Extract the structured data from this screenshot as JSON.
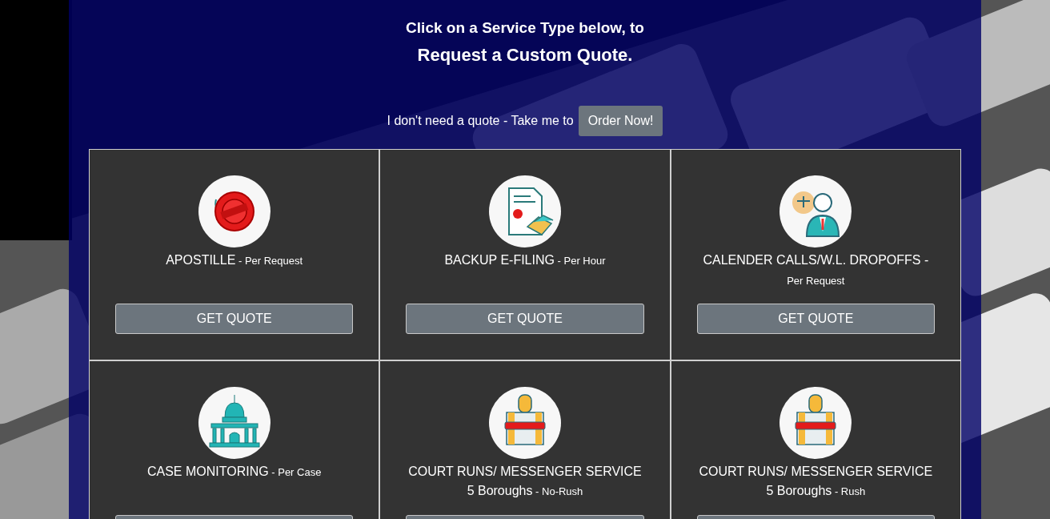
{
  "header": {
    "line_1": "Click on a Service Type below, to",
    "line_2": "Request a Custom Quote."
  },
  "order_prompt": {
    "text": "I don't need a quote - Take me to",
    "button": "Order Now!"
  },
  "services": [
    {
      "kind": "seal",
      "name": "APOSTILLE",
      "unit": "- Per Request",
      "button": "GET QUOTE"
    },
    {
      "kind": "document",
      "name": "BACKUP E-FILING",
      "unit": "- Per Hour",
      "button": "GET QUOTE"
    },
    {
      "kind": "lawyer",
      "name": "CALENDER CALLS/W.L. DROPOFFS -",
      "unit": "Per Request",
      "button": "GET QUOTE"
    },
    {
      "kind": "capitol",
      "name": "CASE MONITORING",
      "unit": "- Per Case"
    },
    {
      "kind": "stamp",
      "name": "COURT RUNS/ MESSENGER SERVICE",
      "subname": "5 Boroughs",
      "unit": "- No-Rush"
    },
    {
      "kind": "stamp",
      "name": "COURT RUNS/ MESSENGER SERVICE",
      "subname": "5 Boroughs",
      "unit": "- Rush"
    }
  ]
}
